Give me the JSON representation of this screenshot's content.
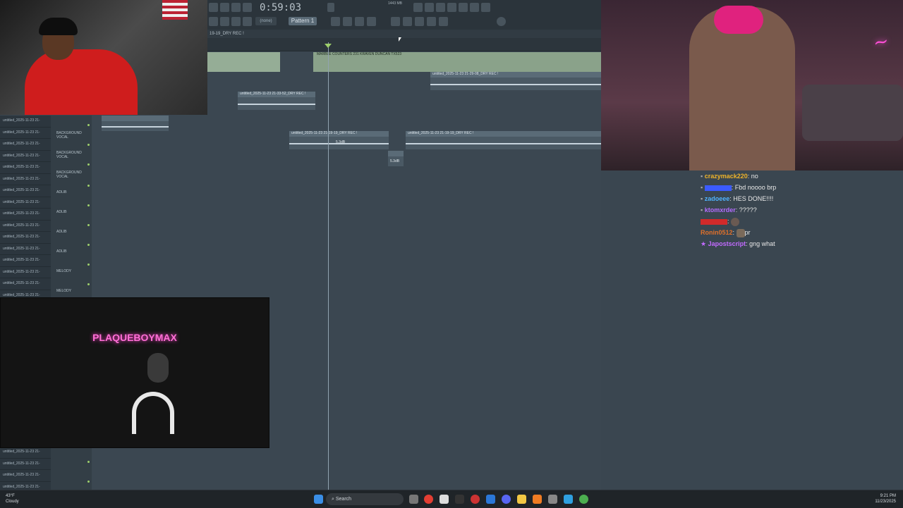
{
  "fl": {
    "time": "0:59:03",
    "pattern": "Pattern 1",
    "snap": "(none)",
    "memory": "1443 MB",
    "playlist_title": "19-19_DRY REC !"
  },
  "clips": {
    "main_label": "MARBLE COUNTERS 231 KRAVEN DUNCAN TX523",
    "clip1": "untitled_2025-11-23 21-29-08_DRY REC !",
    "clip2": "untitled_2025-11-23 21-33-52_DRY REC !",
    "clip3": "untitled_2025-11-23 21-19-19_DRY REC !",
    "clip4": "untitled_2025-11-23 21-19-19_DRY REC !",
    "gain1": "5.3dB",
    "gain2": "5.3dB"
  },
  "browser": {
    "files": [
      "untitled_2025-11-23 21-",
      "untitled_2025-11-23 21-",
      "untitled_2025-11-23 21-",
      "untitled_2025-11-23 21-",
      "untitled_2025-11-23 21-",
      "untitled_2025-11-23 21-",
      "untitled_2025-11-23 21-",
      "untitled_2025-11-23 21-",
      "untitled_2025-11-23 21-",
      "untitled_2025-11-23 21-",
      "untitled_2025-11-23 21-",
      "untitled_2025-11-23 21-",
      "untitled_2025-11-23 21-",
      "untitled_2025-11-23 21-",
      "untitled_2025-11-23 21-",
      "untitled_2025-11-23 21-"
    ],
    "bottom_files": [
      "untitled_2025-11-23 21-",
      "untitled_2025-11-23 21-",
      "untitled_2025-11-23 21-",
      "untitled_2025-11-23 21-"
    ]
  },
  "tracks": [
    "BACKGROUND VOCAL",
    "BACKGROUND VOCAL",
    "BACKGROUND VOCAL",
    "ADLIB",
    "ADLIB",
    "ADLIB",
    "ADLIB",
    "MELODY",
    "MELODY"
  ],
  "studio_logo": "PLAQUEBOYMAX",
  "chat": [
    {
      "user": "crazymack220",
      "msg": "no",
      "color": "#f0b429"
    },
    {
      "user": "",
      "msg": "Fbd noooo brp",
      "color": "#3b5bff"
    },
    {
      "user": "zadoeee",
      "msg": "HES DONE!!!!",
      "color": "#4fb3ff"
    },
    {
      "user": "ktomxrder",
      "msg": "?????",
      "color": "#b36cff"
    },
    {
      "user": "",
      "msg": "",
      "color": "#d12a2a"
    },
    {
      "user": "Ronin0512",
      "msg": "pr",
      "color": "#e0702a"
    },
    {
      "user": "Japostscript",
      "msg": "gng what",
      "color": "#c26bff"
    }
  ],
  "taskbar": {
    "search": "Search",
    "weather_temp": "43°F",
    "weather_desc": "Cloudy",
    "time": "9:21 PM",
    "date": "11/23/2025"
  }
}
